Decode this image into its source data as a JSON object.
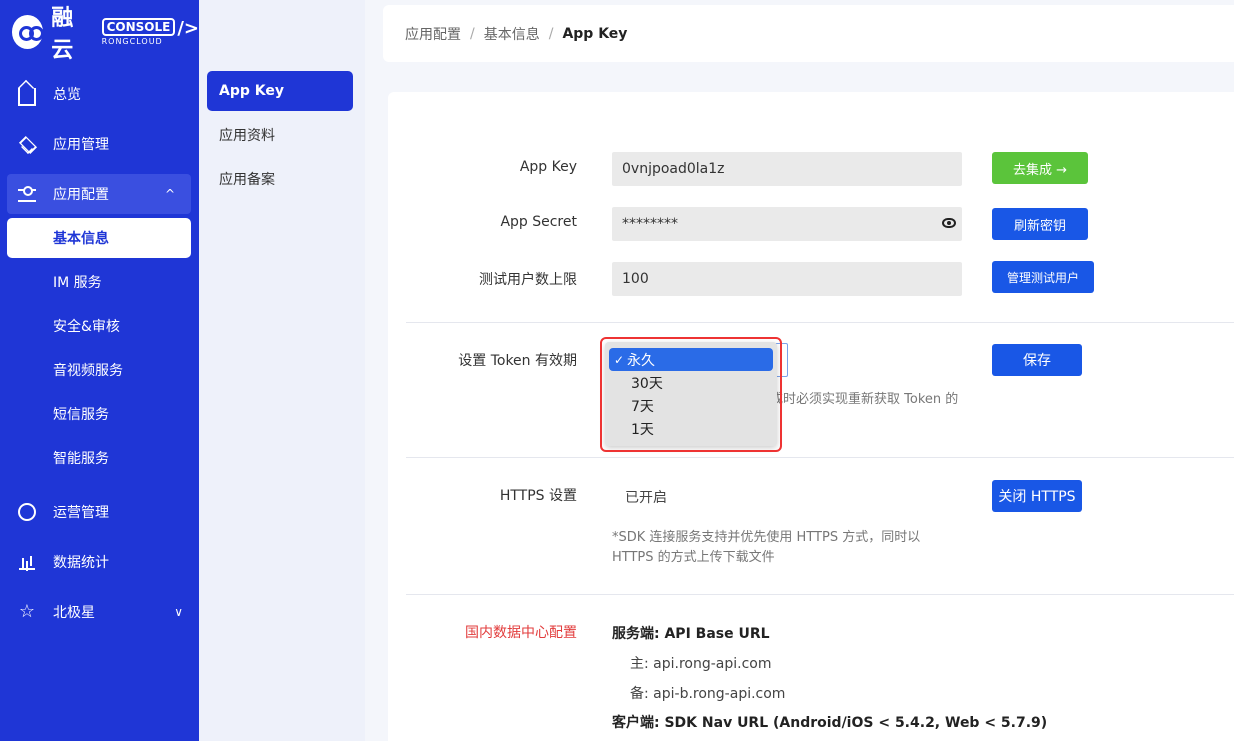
{
  "brand": {
    "name": "融云",
    "console": "CONSOLE",
    "sub": "RONGCLOUD",
    "slash": "/>"
  },
  "sidebar": {
    "items": [
      {
        "label": "总览",
        "icon": "home-icon"
      },
      {
        "label": "应用管理",
        "icon": "layers-icon"
      },
      {
        "label": "应用配置",
        "icon": "sliders-icon",
        "arrow": "^"
      },
      {
        "label": "运营管理",
        "icon": "ring-icon"
      },
      {
        "label": "数据统计",
        "icon": "bar-chart-icon"
      },
      {
        "label": "北极星",
        "icon": "star-icon",
        "arrow": "∨"
      }
    ],
    "subitems": [
      "基本信息",
      "IM 服务",
      "安全&审核",
      "音视频服务",
      "短信服务",
      "智能服务"
    ]
  },
  "subnav": {
    "items": [
      "App Key",
      "应用资料",
      "应用备案"
    ]
  },
  "breadcrumb": {
    "items": [
      "应用配置",
      "基本信息"
    ],
    "current": "App Key",
    "sep": "/"
  },
  "form": {
    "app_key": {
      "label": "App Key",
      "value": "0vnjpoad0la1z",
      "button": "去集成 →"
    },
    "app_secret": {
      "label": "App Secret",
      "value": "********",
      "button": "刷新密钥"
    },
    "test_users": {
      "label": "测试用户数上限",
      "value": "100",
      "button": "管理测试用户"
    },
    "token": {
      "label": "设置 Token 有效期",
      "button": "保存",
      "hint_visible": "或时必须实现重新获取 Token 的",
      "options": [
        "永久",
        "30天",
        "7天",
        "1天"
      ],
      "selected": "永久",
      "check": "✓"
    },
    "https": {
      "label": "HTTPS 设置",
      "value": "已开启",
      "button": "关闭 HTTPS",
      "note_line1": "*SDK 连接服务支持并优先使用 HTTPS 方式，同时以",
      "note_line2": "HTTPS 的方式上传下载文件"
    },
    "datacenter": {
      "label": "国内数据中心配置",
      "server_title": "服务端: API Base URL",
      "primary": "主: api.rong-api.com",
      "backup": "备: api-b.rong-api.com",
      "client_title": "客户端: SDK Nav URL (Android/iOS < 5.4.2, Web < 5.7.9)"
    }
  },
  "colors": {
    "sidebar": "#1f36d6",
    "primary_button": "#1957e6",
    "green_button": "#5bc43b",
    "highlight_red": "#e33333"
  }
}
